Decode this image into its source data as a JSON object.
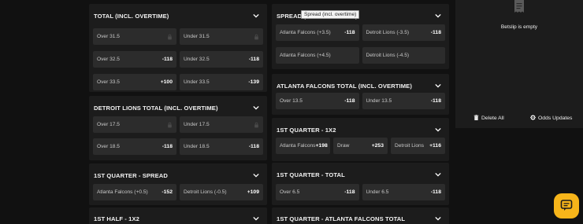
{
  "tooltip": "Spread (incl. overtime)",
  "left_markets": [
    {
      "title": "TOTAL (INCL. OVERTIME)",
      "rows": [
        [
          {
            "label": "Over 31.5",
            "odds": "",
            "locked": true
          },
          {
            "label": "Under 31.5",
            "odds": "",
            "locked": true
          }
        ],
        [
          {
            "label": "Over 32.5",
            "odds": "-118"
          },
          {
            "label": "Under 32.5",
            "odds": "-118"
          }
        ],
        [
          {
            "label": "Over 33.5",
            "odds": "+100"
          },
          {
            "label": "Under 33.5",
            "odds": "-139"
          }
        ]
      ]
    },
    {
      "title": "DETROIT LIONS TOTAL (INCL. OVERTIME)",
      "rows": [
        [
          {
            "label": "Over 17.5",
            "odds": "",
            "locked": true
          },
          {
            "label": "Under 17.5",
            "odds": "",
            "locked": true
          }
        ],
        [
          {
            "label": "Over 18.5",
            "odds": "-118"
          },
          {
            "label": "Under 18.5",
            "odds": "-118"
          }
        ]
      ]
    },
    {
      "title": "1ST QUARTER - SPREAD",
      "rows": [
        [
          {
            "label": "Atlanta Falcons (+0.5)",
            "odds": "-152"
          },
          {
            "label": "Detroit Lions (-0.5)",
            "odds": "+109"
          }
        ]
      ]
    },
    {
      "title": "1ST HALF - 1X2",
      "rows": []
    }
  ],
  "mid_markets": [
    {
      "title": "SPREAD (INCL. OVERTIME)",
      "rows": [
        [
          {
            "label": "Atlanta Falcons (+3.5)",
            "odds": "-118"
          },
          {
            "label": "Detroit Lions (-3.5)",
            "odds": "-118"
          }
        ],
        [
          {
            "label": "Atlanta Falcons (+4.5)",
            "odds": ""
          },
          {
            "label": "Detroit Lions (-4.5)",
            "odds": ""
          }
        ]
      ]
    },
    {
      "title": "ATLANTA FALCONS TOTAL (INCL. OVERTIME)",
      "rows": [
        [
          {
            "label": "Over 13.5",
            "odds": "-118"
          },
          {
            "label": "Under 13.5",
            "odds": "-118"
          }
        ]
      ]
    },
    {
      "title": "1ST QUARTER - 1X2",
      "rows": [
        [
          {
            "label": "Atlanta Falcons",
            "odds": "+198"
          },
          {
            "label": "Draw",
            "odds": "+253"
          },
          {
            "label": "Detroit Lions",
            "odds": "+116"
          }
        ]
      ]
    },
    {
      "title": "1ST QUARTER - TOTAL",
      "rows": [
        [
          {
            "label": "Over 6.5",
            "odds": "-118"
          },
          {
            "label": "Under 6.5",
            "odds": "-118"
          }
        ]
      ]
    },
    {
      "title": "1ST QUARTER - ATLANTA FALCONS TOTAL",
      "rows": []
    }
  ],
  "betslip": {
    "empty_text": "Betslip is empty",
    "delete_all": "Delete All",
    "odds_updates": "Odds Updates"
  },
  "colors": {
    "background": "#111111",
    "panel": "#1c1c1c",
    "button": "#2c2c2c",
    "accent": "#f7b51a"
  }
}
